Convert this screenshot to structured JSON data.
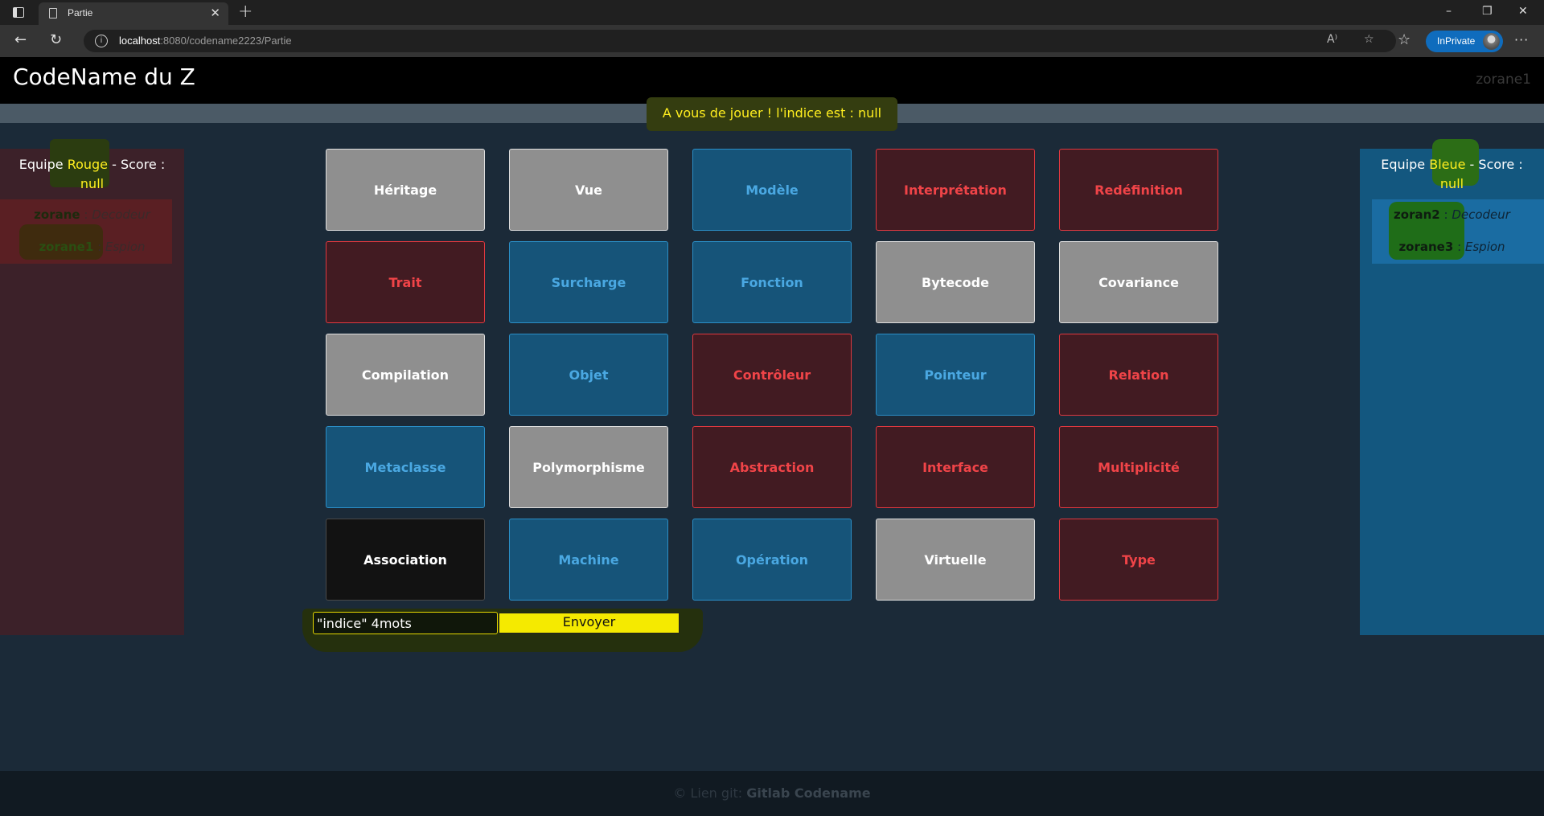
{
  "browser": {
    "tab_title": "Partie",
    "tab_close": "✕",
    "new_tab": "+",
    "url_host": "localhost",
    "url_rest": ":8080/codename2223/Partie",
    "inprivate_label": "InPrivate",
    "window_controls": [
      "–",
      "❐",
      "✕"
    ]
  },
  "header": {
    "title": "CodeName du Z",
    "user": "zorane1"
  },
  "status": {
    "message": "A vous de jouer ! l'indice est : null"
  },
  "teams": {
    "red": {
      "prefix": "Equipe ",
      "name": "Rouge",
      "suffix": " - Score :",
      "score": "null",
      "players": [
        {
          "name": "zorane",
          "role": "Decodeur"
        },
        {
          "name": "zorane1",
          "role": "Espion"
        }
      ]
    },
    "blue": {
      "prefix": "Equipe ",
      "name": "Bleue",
      "suffix": " - Score :",
      "score": "null",
      "players": [
        {
          "name": "zoran2",
          "role": "Decodeur"
        },
        {
          "name": "zorane3",
          "role": "Espion"
        }
      ]
    }
  },
  "board": {
    "cards": [
      {
        "word": "Héritage",
        "color": "neutral"
      },
      {
        "word": "Vue",
        "color": "neutral"
      },
      {
        "word": "Modèle",
        "color": "blue"
      },
      {
        "word": "Interprétation",
        "color": "red"
      },
      {
        "word": "Redéfinition",
        "color": "red"
      },
      {
        "word": "Trait",
        "color": "red"
      },
      {
        "word": "Surcharge",
        "color": "blue"
      },
      {
        "word": "Fonction",
        "color": "blue"
      },
      {
        "word": "Bytecode",
        "color": "neutral"
      },
      {
        "word": "Covariance",
        "color": "neutral"
      },
      {
        "word": "Compilation",
        "color": "neutral"
      },
      {
        "word": "Objet",
        "color": "blue"
      },
      {
        "word": "Contrôleur",
        "color": "red"
      },
      {
        "word": "Pointeur",
        "color": "blue"
      },
      {
        "word": "Relation",
        "color": "red"
      },
      {
        "word": "Metaclasse",
        "color": "blue"
      },
      {
        "word": "Polymorphisme",
        "color": "neutral"
      },
      {
        "word": "Abstraction",
        "color": "red"
      },
      {
        "word": "Interface",
        "color": "red"
      },
      {
        "word": "Multiplicité",
        "color": "red"
      },
      {
        "word": "Association",
        "color": "black"
      },
      {
        "word": "Machine",
        "color": "blue"
      },
      {
        "word": "Opération",
        "color": "blue"
      },
      {
        "word": "Virtuelle",
        "color": "neutral"
      },
      {
        "word": "Type",
        "color": "red"
      }
    ]
  },
  "clue_form": {
    "input_value": "\"indice\" 4mots",
    "send_label": "Envoyer"
  },
  "footer": {
    "text": "© Lien git: ",
    "link": "Gitlab Codename"
  }
}
